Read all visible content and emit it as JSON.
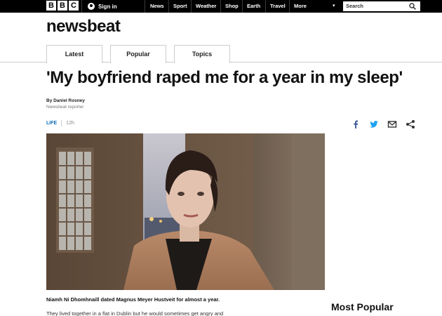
{
  "topbar": {
    "logo_letters": [
      "B",
      "B",
      "C"
    ],
    "signin_label": "Sign in",
    "nav_items": [
      "News",
      "Sport",
      "Weather",
      "Shop",
      "Earth",
      "Travel",
      "More"
    ],
    "search_placeholder": "Search"
  },
  "brand": "newsbeat",
  "tabs": [
    {
      "label": "Latest"
    },
    {
      "label": "Popular"
    },
    {
      "label": "Topics"
    }
  ],
  "article": {
    "headline": "'My boyfriend raped me for a year in my sleep'",
    "byline": "By Daniel Rosney",
    "role": "Newsbeat reporter",
    "category": "LIFE",
    "time": "12h",
    "caption_lead": "Niamh Ni Dhomhnaill dated Magnus Meyer Hustveit for almost a year.",
    "para1": "They lived together in a flat in Dublin but he would sometimes get angry and"
  },
  "share_icons": [
    "facebook-icon",
    "twitter-icon",
    "email-icon",
    "share-icon"
  ],
  "sidebar": {
    "most_popular": "Most Popular"
  },
  "colors": {
    "topbar": "#000000",
    "accent_blue": "#0b6fb8",
    "facebook": "#3b5998",
    "twitter": "#1da1f2"
  }
}
